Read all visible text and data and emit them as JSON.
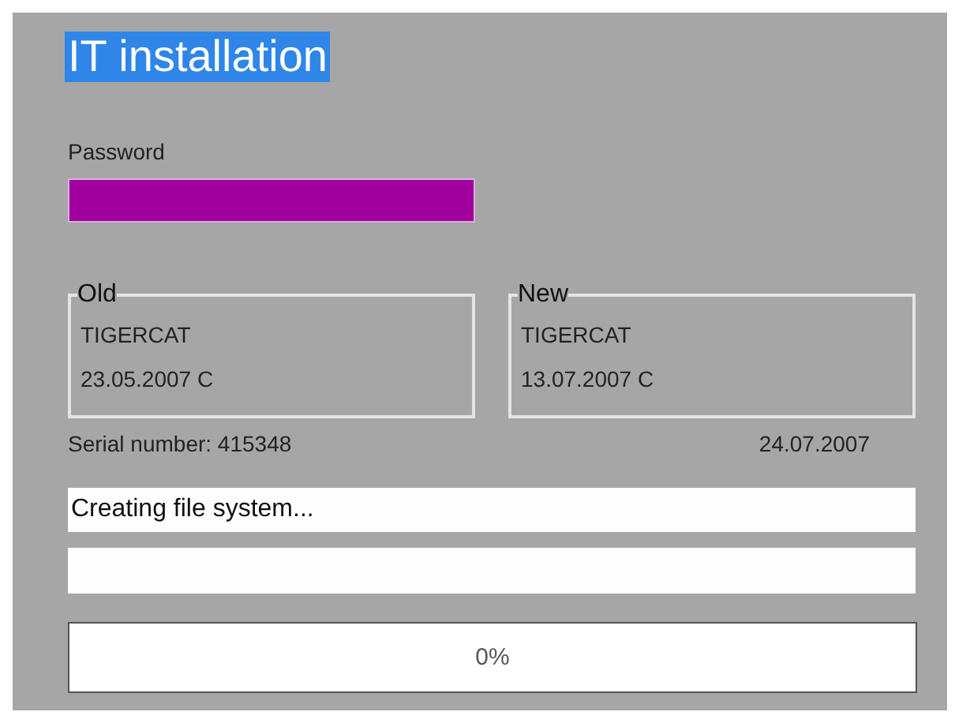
{
  "title": {
    "text": "IT installation",
    "selected": true
  },
  "password": {
    "label": "Password"
  },
  "versions": [
    {
      "legend": "Old",
      "name": "TIGERCAT",
      "date": "23.05.2007 C"
    },
    {
      "legend": "New",
      "name": "TIGERCAT",
      "date": "13.07.2007 C"
    }
  ],
  "serial": "Serial number: 415348",
  "date": "24.07.2007",
  "status": "Creating file system...",
  "progress": {
    "level": 0,
    "reading": "0%"
  }
}
